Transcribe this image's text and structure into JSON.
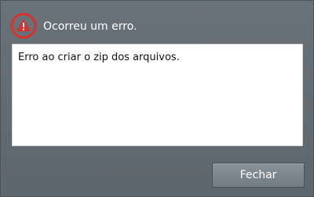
{
  "dialog": {
    "title": "Ocorreu um erro.",
    "icon": "warning-icon",
    "message": "Erro ao criar o zip dos arquivos.",
    "close_label": "Fechar"
  },
  "colors": {
    "background": "#646c73",
    "icon_red": "#d9312c",
    "message_background": "#ffffff",
    "button": "#7f878e"
  }
}
